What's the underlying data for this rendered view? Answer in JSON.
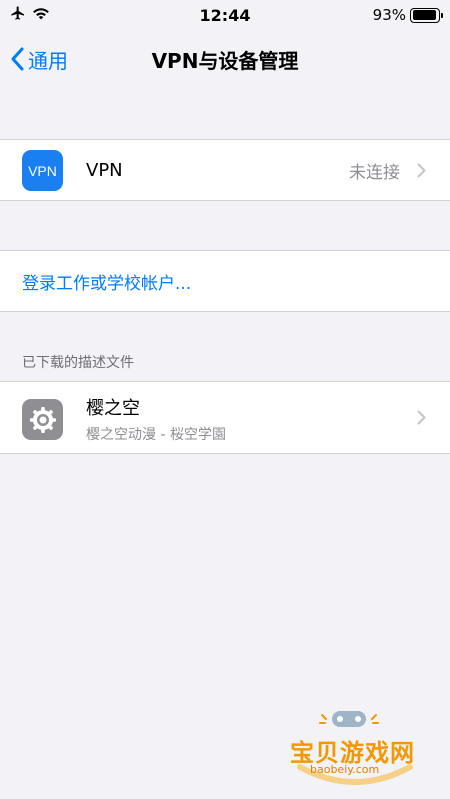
{
  "status_bar": {
    "time": "12:44",
    "battery_percent": "93%",
    "battery_level": 0.93
  },
  "nav": {
    "back_label": "通用",
    "title": "VPN与设备管理"
  },
  "vpn_row": {
    "icon_text": "VPN",
    "label": "VPN",
    "status": "未连接"
  },
  "account": {
    "link_label": "登录工作或学校帐户..."
  },
  "profiles": {
    "section_header": "已下载的描述文件",
    "items": [
      {
        "name": "樱之空",
        "subtitle": "樱之空动漫 - 桜空学園"
      }
    ]
  },
  "watermark": {
    "text": "宝贝游戏网",
    "url": "baobeiy.com"
  },
  "colors": {
    "accent": "#007aff",
    "background": "#f2f2f7",
    "vpn_icon": "#1a7ff0",
    "watermark": "#f39800"
  }
}
